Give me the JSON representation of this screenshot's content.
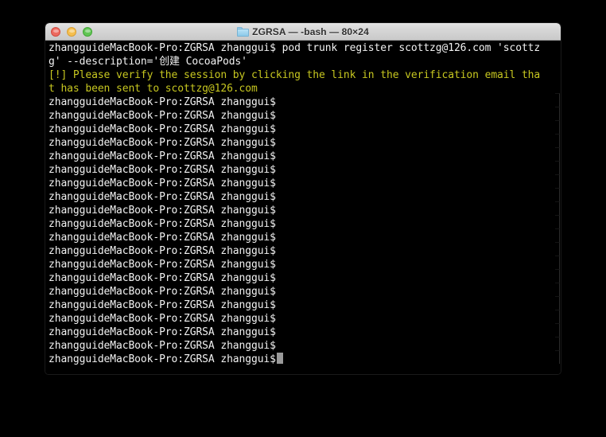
{
  "window": {
    "title": "ZGRSA — -bash — 80×24",
    "folder_icon": "folder-icon",
    "controls": {
      "close": "close",
      "minimize": "minimize",
      "zoom": "zoom"
    },
    "colors": {
      "titlebar_top": "#e4e4e4",
      "titlebar_bottom": "#c9c9c9",
      "terminal_background": "#000000",
      "terminal_foreground": "#f2f2f2",
      "warning_text": "#c7c720",
      "close_button": "#ec6a5f",
      "minimize_button": "#f5bf4f",
      "zoom_button": "#61c554",
      "cursor": "#9a9a9a",
      "folder_icon": "#8cc9e9"
    }
  },
  "terminal": {
    "prompt": "zhangguideMacBook-Pro:ZGRSA zhanggui$",
    "lines": [
      {
        "text": "zhangguideMacBook-Pro:ZGRSA zhanggui$ pod trunk register scottzg@126.com 'scottz",
        "style": "normal"
      },
      {
        "text": "g' --description='创建 CocoaPods'",
        "style": "normal"
      },
      {
        "text": "[!] Please verify the session by clicking the link in the verification email tha",
        "style": "warn"
      },
      {
        "text": "t has been sent to scottzg@126.com",
        "style": "warn"
      },
      {
        "text": "zhangguideMacBook-Pro:ZGRSA zhanggui$",
        "style": "normal"
      },
      {
        "text": "zhangguideMacBook-Pro:ZGRSA zhanggui$",
        "style": "normal"
      },
      {
        "text": "zhangguideMacBook-Pro:ZGRSA zhanggui$",
        "style": "normal"
      },
      {
        "text": "zhangguideMacBook-Pro:ZGRSA zhanggui$",
        "style": "normal"
      },
      {
        "text": "zhangguideMacBook-Pro:ZGRSA zhanggui$",
        "style": "normal"
      },
      {
        "text": "zhangguideMacBook-Pro:ZGRSA zhanggui$",
        "style": "normal"
      },
      {
        "text": "zhangguideMacBook-Pro:ZGRSA zhanggui$",
        "style": "normal"
      },
      {
        "text": "zhangguideMacBook-Pro:ZGRSA zhanggui$",
        "style": "normal"
      },
      {
        "text": "zhangguideMacBook-Pro:ZGRSA zhanggui$",
        "style": "normal"
      },
      {
        "text": "zhangguideMacBook-Pro:ZGRSA zhanggui$",
        "style": "normal"
      },
      {
        "text": "zhangguideMacBook-Pro:ZGRSA zhanggui$",
        "style": "normal"
      },
      {
        "text": "zhangguideMacBook-Pro:ZGRSA zhanggui$",
        "style": "normal"
      },
      {
        "text": "zhangguideMacBook-Pro:ZGRSA zhanggui$",
        "style": "normal"
      },
      {
        "text": "zhangguideMacBook-Pro:ZGRSA zhanggui$",
        "style": "normal"
      },
      {
        "text": "zhangguideMacBook-Pro:ZGRSA zhanggui$",
        "style": "normal"
      },
      {
        "text": "zhangguideMacBook-Pro:ZGRSA zhanggui$",
        "style": "normal"
      },
      {
        "text": "zhangguideMacBook-Pro:ZGRSA zhanggui$",
        "style": "normal"
      },
      {
        "text": "zhangguideMacBook-Pro:ZGRSA zhanggui$",
        "style": "normal"
      },
      {
        "text": "zhangguideMacBook-Pro:ZGRSA zhanggui$",
        "style": "normal"
      }
    ],
    "current_line": {
      "text": "zhangguideMacBook-Pro:ZGRSA zhanggui$",
      "cursor": "block"
    }
  }
}
